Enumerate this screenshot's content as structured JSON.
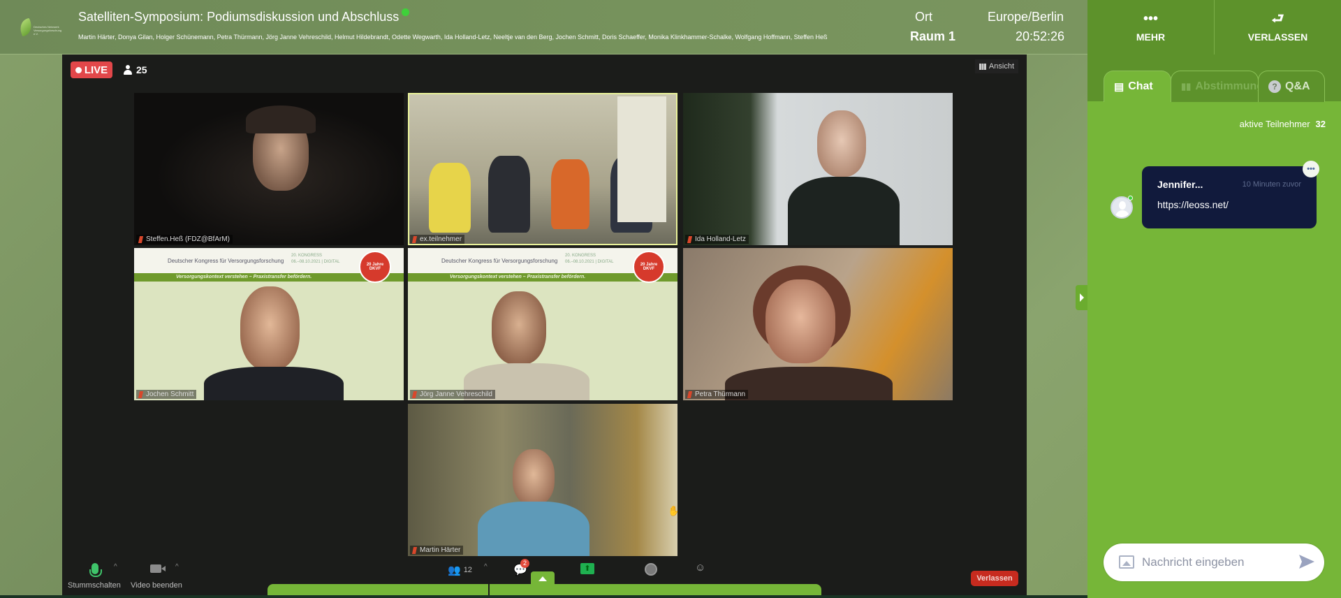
{
  "header": {
    "title": "Satelliten-Symposium: Podiumsdiskussion und Abschluss",
    "speakers": "Martin Härter, Donya Gilan, Holger Schünemann, Petra Thürmann, Jörg Janne Vehreschild, Helmut Hildebrandt, Odette Wegwarth, Ida Holland-Letz, Neeltje van den Berg, Jochen Schmitt, Doris Schaeffer, Monika Klinkhammer-Schalke, Wolfgang Hoffmann, Steffen Heß",
    "location_label": "Ort",
    "location_value": "Raum 1",
    "timezone_label": "Europe/Berlin",
    "time": "20:52:26",
    "logo_text": "Deutsches Netzwerk Versorgungsforschung e.V.",
    "more_label": "MEHR",
    "leave_label": "VERLASSEN"
  },
  "stage": {
    "live_label": "LIVE",
    "viewer_count": "25",
    "view_label": "Ansicht",
    "tiles": [
      {
        "name": "Steffen.Heß (FDZ@BfArM)"
      },
      {
        "name": "ex.teilnehmer"
      },
      {
        "name": "Ida Holland-Letz"
      },
      {
        "name": "Jochen Schmitt"
      },
      {
        "name": "Jörg Janne Vehreschild"
      },
      {
        "name": "Petra Thürmann"
      },
      {
        "name": "Martin Härter"
      }
    ],
    "banner": {
      "congress": "Deutscher Kongress für Versorgungsforschung",
      "edition": "20. KONGRESS",
      "dates": "06.–08.10.2021 | DIGITAL",
      "slogan": "Versorgungskontext verstehen – Praxistransfer befördern.",
      "badge": "20 Jahre DKVF"
    },
    "toolbar": {
      "mute_label": "Stummschalten",
      "video_label": "Video beenden",
      "participants_count": "12",
      "chat_badge": "2",
      "leave_label": "Verlassen"
    }
  },
  "sidebar": {
    "tabs": [
      {
        "label": "Chat",
        "active": true
      },
      {
        "label": "Abstimmung",
        "active": false
      },
      {
        "label": "Q&A",
        "active": false
      }
    ],
    "active_users_label": "aktive Teilnehmer",
    "active_users_count": "32",
    "messages": [
      {
        "author": "Jennifer...",
        "time": "10 Minuten zuvor",
        "text": "https://leoss.net/"
      }
    ],
    "input_placeholder": "Nachricht eingeben"
  },
  "colors": {
    "accent_green": "#76b638",
    "header_green": "#5d922b",
    "live_red": "#e2474a",
    "bubble_navy": "#111a3c"
  }
}
